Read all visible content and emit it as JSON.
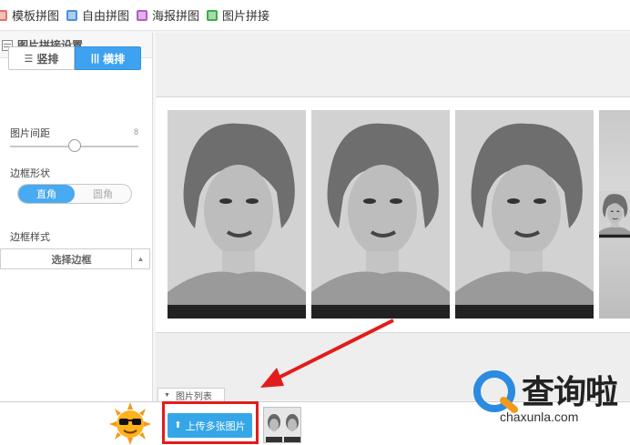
{
  "tabs": [
    {
      "label": "模板拼图",
      "color": "#e9735f"
    },
    {
      "label": "自由拼图",
      "color": "#4a90d9"
    },
    {
      "label": "海报拼图",
      "color": "#b85ac9"
    },
    {
      "label": "图片拼接",
      "color": "#3fae49"
    }
  ],
  "panel": {
    "title": "图片拼接设置",
    "layout_vertical": "竖排",
    "layout_horizontal": "横排",
    "spacing_label": "图片间距",
    "spacing_value": "8",
    "border_shape_label": "边框形状",
    "shape_square": "直角",
    "shape_round": "圆角",
    "border_style_label": "边框样式",
    "choose_border": "选择边框"
  },
  "list": {
    "tab_label": "图片列表",
    "upload_label": "上传多张图片"
  },
  "watermark": {
    "brand": "查询啦",
    "domain": "chaxunla.com"
  },
  "colors": {
    "accent": "#3ea2f0",
    "highlight": "#e21c1c"
  }
}
